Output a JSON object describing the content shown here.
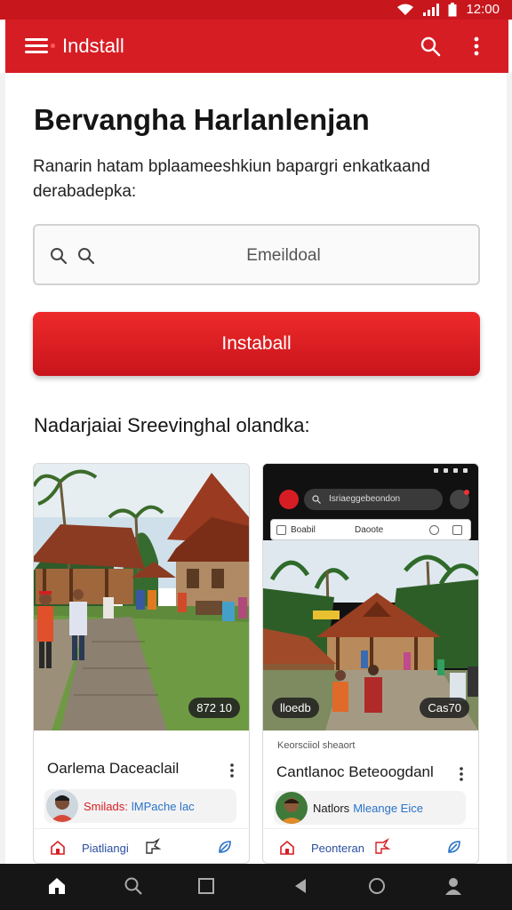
{
  "status_bar": {
    "time": "12:00"
  },
  "app_bar": {
    "title": "Indstall"
  },
  "page": {
    "title": "Bervangha Harlanlenjan",
    "description": "Ranarin hatam bplaameeshkiun bapargri enkatkaand derabadepka:"
  },
  "search": {
    "placeholder": "Emeildoal"
  },
  "install_button": {
    "label": "Instaball"
  },
  "section": {
    "title": "Nadarjaiai  Sreevinghal olandka:"
  },
  "cards": [
    {
      "duration": "872 10",
      "title": "Oarlema Daceaclail",
      "author_name": "Smilads:",
      "author_handle": "lMPache lac",
      "action_label": "Piatliangi"
    },
    {
      "duration": "Cas70",
      "shot_url": "Isriaeggebeondon",
      "shot_tab1": "Boabil",
      "shot_tab2": "Daoote",
      "overlay_left": "lloedb",
      "subtitle": "Keorsciiol sheaort",
      "title": "Cantlanoc Beteoogdanl",
      "author_name": "Natlors",
      "author_handle": "Mleange Eice",
      "action_label": "Peonteran"
    }
  ],
  "colors": {
    "primary": "#d71d24",
    "status_bar": "#c8161d",
    "link": "#2a73c8",
    "nav_bar": "#161616"
  },
  "icons": [
    "menu-icon",
    "search-icon",
    "more-vert-icon",
    "home-icon",
    "shape-icon",
    "leaf-icon",
    "back-icon",
    "circle-icon",
    "square-icon",
    "person-icon"
  ]
}
